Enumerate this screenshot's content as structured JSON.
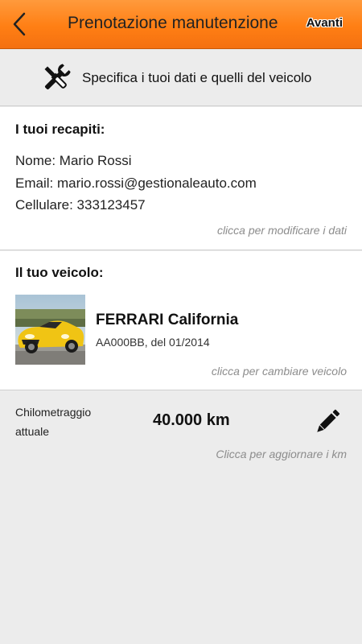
{
  "header": {
    "back_icon": "chevron-left-icon",
    "title": "Prenotazione manutenzione",
    "next_label": "Avanti",
    "accent": "#ff8419"
  },
  "intro": {
    "icon": "tools-icon",
    "text": "Specifica i tuoi dati e quelli del veicolo"
  },
  "contacts": {
    "heading": "I tuoi recapiti:",
    "name": "Nome: Mario Rossi",
    "email": "Email: mario.rossi@gestionaleauto.com",
    "phone": "Cellulare: 333123457",
    "hint": "clicca per modificare i dati"
  },
  "vehicle": {
    "heading": "Il tuo veicolo:",
    "photo": "yellow-convertible-car-image",
    "name": "FERRARI California",
    "plate_date": "AA000BB, del 01/2014",
    "hint": "clicca per cambiare veicolo"
  },
  "mileage": {
    "label": "Chilometraggio attuale",
    "value": "40.000 km",
    "edit_icon": "pencil-icon",
    "hint": "Clicca per aggiornare i km"
  }
}
